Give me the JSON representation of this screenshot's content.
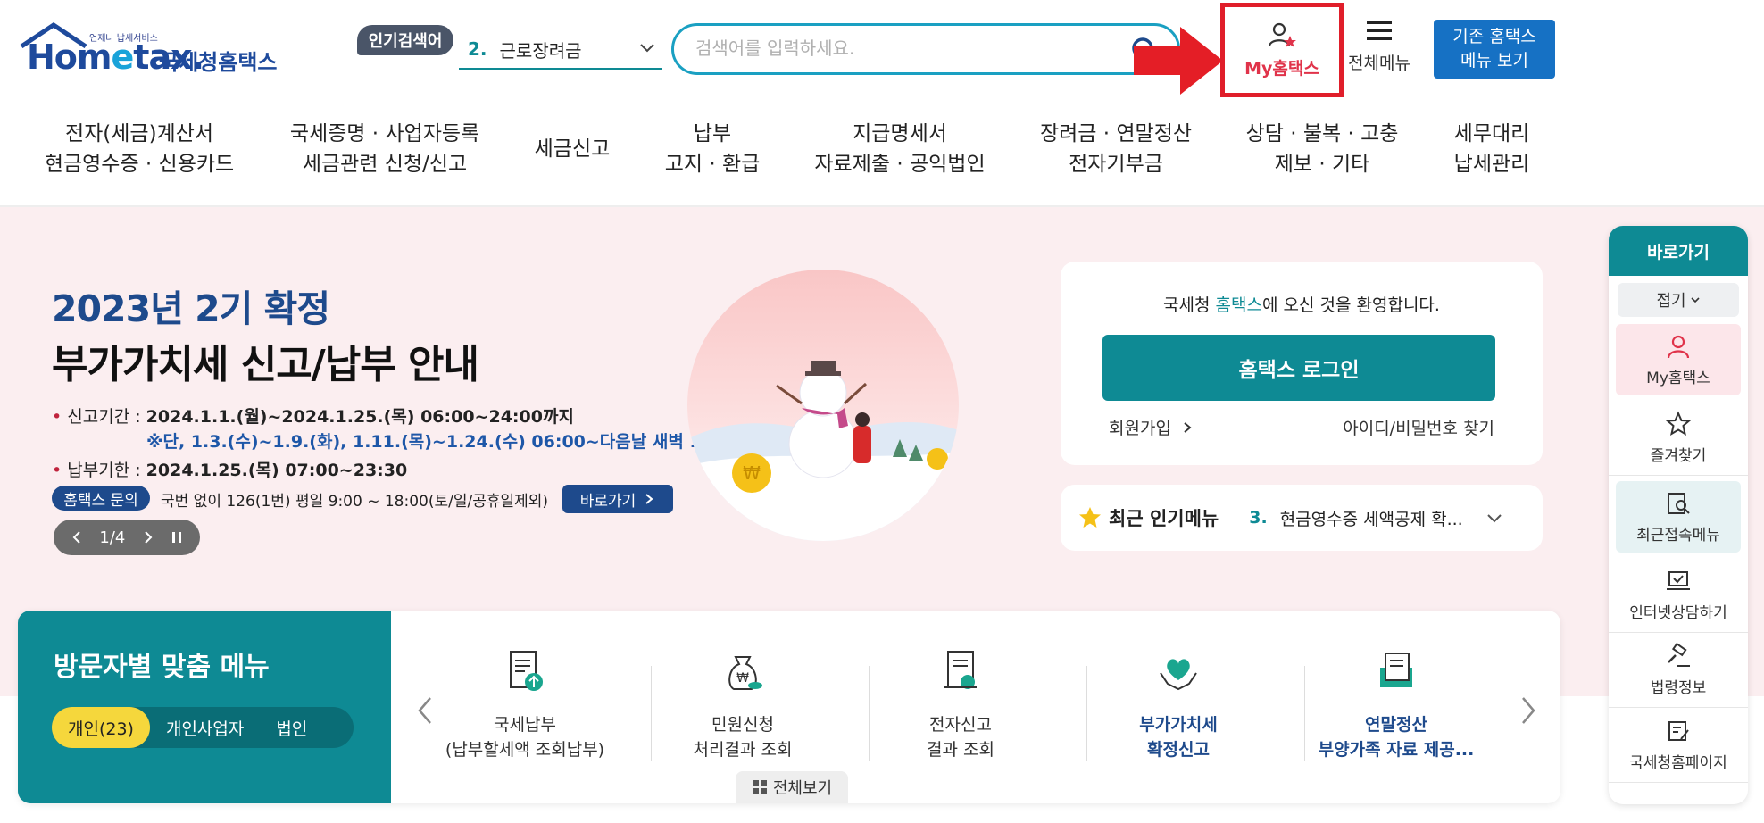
{
  "logo": {
    "small": "언제나 납세서비스",
    "main_1": "Hom",
    "main_e": "e",
    "main_2": "tax.",
    "kr": "국세청홈택스"
  },
  "header": {
    "popular_badge": "인기검색어",
    "popular_rank": "2.",
    "popular_term": "근로장려금",
    "search_placeholder": "검색어를 입력하세요.",
    "my_hometax": "My홈택스",
    "all_menu": "전체메뉴",
    "old_menu_1": "기존 홈택스",
    "old_menu_2": "메뉴 보기"
  },
  "gnb": [
    {
      "l1": "전자(세금)계산서",
      "l2": "현금영수증 · 신용카드"
    },
    {
      "l1": "국세증명 · 사업자등록",
      "l2": "세금관련 신청/신고"
    },
    {
      "l1": "세금신고",
      "l2": ""
    },
    {
      "l1": "납부",
      "l2": "고지 · 환급"
    },
    {
      "l1": "지급명세서",
      "l2": "자료제출 · 공익법인"
    },
    {
      "l1": "장려금 · 연말정산",
      "l2": "전자기부금"
    },
    {
      "l1": "상담 · 불복 · 고충",
      "l2": "제보 · 기타"
    },
    {
      "l1": "세무대리",
      "l2": "납세관리"
    }
  ],
  "hero": {
    "title1": "2023년 2기 확정",
    "title2": "부가가치세 신고/납부 안내",
    "period_label": "신고기간 :",
    "period_value": "2024.1.1.(월)~2024.1.25.(목) 06:00~24:00까지",
    "period_note": "※단, 1.3.(수)~1.9.(화), 1.11.(목)~1.24.(수) 06:00~다음날 새벽 1:00",
    "due_label": "납부기한 :",
    "due_value": "2024.1.25.(목) 07:00~23:30",
    "contact_pill": "홈택스 문의",
    "contact_text": "국번 없이 126(1번) 평일 9:00 ~ 18:00(토/일/공휴일제외)",
    "go_button": "바로가기",
    "pager": "1/4"
  },
  "login": {
    "welcome_pre": "국세청 ",
    "welcome_hl": "홈택스",
    "welcome_post": "에 오신 것을 환영합니다.",
    "login_button": "홈택스 로그인",
    "signup": "회원가입",
    "find": "아이디/비밀번호 찾기"
  },
  "popular_menu": {
    "title": "최근 인기메뉴",
    "rank": "3.",
    "item": "현금영수증 세액공제 확..."
  },
  "visitor": {
    "title": "방문자별 맞춤 메뉴",
    "tabs": [
      "개인(23)",
      "개인사업자",
      "법인"
    ],
    "items": [
      {
        "l1": "국세납부",
        "l2": "(납부할세액 조회납부)"
      },
      {
        "l1": "민원신청",
        "l2": "처리결과 조회"
      },
      {
        "l1": "전자신고",
        "l2": "결과 조회"
      },
      {
        "l1": "부가가치세",
        "l2": "확정신고"
      },
      {
        "l1": "연말정산",
        "l2": "부양가족 자료 제공..."
      }
    ],
    "view_all": "전체보기"
  },
  "quick": {
    "title": "바로가기",
    "fold": "접기",
    "items": [
      "My홈택스",
      "즐겨찾기",
      "최근접속메뉴",
      "인터넷상담하기",
      "법령정보",
      "국세청홈페이지"
    ]
  },
  "colors": {
    "teal": "#0e8a94",
    "navy": "#1e4a8c",
    "highlight_red": "#e01e2a",
    "hero_bg": "#fbeef0"
  }
}
